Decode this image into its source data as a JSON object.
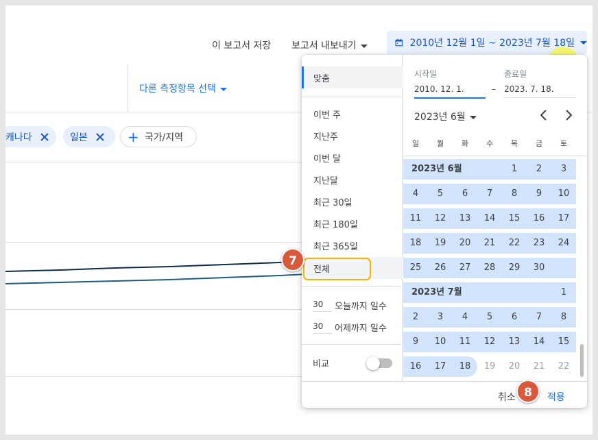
{
  "toolbar": {
    "save_label": "이 보고서 저장",
    "export_label": "보고서 내보내기",
    "date_range_label": "2010년 12월 1일 ~ 2023년 7월 18일"
  },
  "metrics": {
    "select_other_label": "다른 측정항목 선택"
  },
  "filters": {
    "chips": [
      {
        "label": "캐나다"
      },
      {
        "label": "일본"
      }
    ],
    "add_label": "국가/지역"
  },
  "presets": {
    "items": [
      "맞춤",
      "이번 주",
      "지난주",
      "이번 달",
      "지난달",
      "최근 30일",
      "최근 180일",
      "최근 365일",
      "전체"
    ],
    "active": "맞춤",
    "hovered": "전체",
    "days_until_today": {
      "value": "30",
      "label": "오늘까지 일수"
    },
    "days_until_yesterday": {
      "value": "30",
      "label": "어제까지 일수"
    },
    "compare_label": "비교",
    "compare_on": false
  },
  "calendar": {
    "start_label": "시작일",
    "start_value": "2010. 12. 1.",
    "end_label": "종료일",
    "end_value": "2023. 7. 18.",
    "dash": "–",
    "month_selector": "2023년 6월",
    "weekdays": [
      "일",
      "월",
      "화",
      "수",
      "목",
      "금",
      "토"
    ],
    "june_header": "2023년 6월",
    "july_header": "2023년 7월",
    "june_rows": [
      [
        "",
        "",
        "",
        "",
        "1",
        "2",
        "3"
      ],
      [
        "4",
        "5",
        "6",
        "7",
        "8",
        "9",
        "10"
      ],
      [
        "11",
        "12",
        "13",
        "14",
        "15",
        "16",
        "17"
      ],
      [
        "18",
        "19",
        "20",
        "21",
        "22",
        "23",
        "24"
      ],
      [
        "25",
        "26",
        "27",
        "28",
        "29",
        "30",
        ""
      ]
    ],
    "july_rows": [
      [
        "",
        "",
        "",
        "",
        "",
        "",
        "1"
      ],
      [
        "2",
        "3",
        "4",
        "5",
        "6",
        "7",
        "8"
      ],
      [
        "9",
        "10",
        "11",
        "12",
        "13",
        "14",
        "15"
      ],
      [
        "16",
        "17",
        "18",
        "19",
        "20",
        "21",
        "22"
      ]
    ],
    "selected_through": "18"
  },
  "footer": {
    "cancel_label": "취소",
    "apply_label": "적용"
  },
  "annotations": {
    "step_7": "7",
    "step_8": "8"
  },
  "colors": {
    "accent": "#1a73e8",
    "range_fill": "#d2e3fc",
    "step_badge": "#d9593c",
    "highlight_outline": "#f4b400"
  },
  "icons": {
    "date_button": "calendar-icon",
    "chip_remove": "close-icon",
    "cursor": "hand-pointer-icon",
    "prev_month": "chevron-left-icon",
    "next_month": "chevron-right-icon"
  }
}
